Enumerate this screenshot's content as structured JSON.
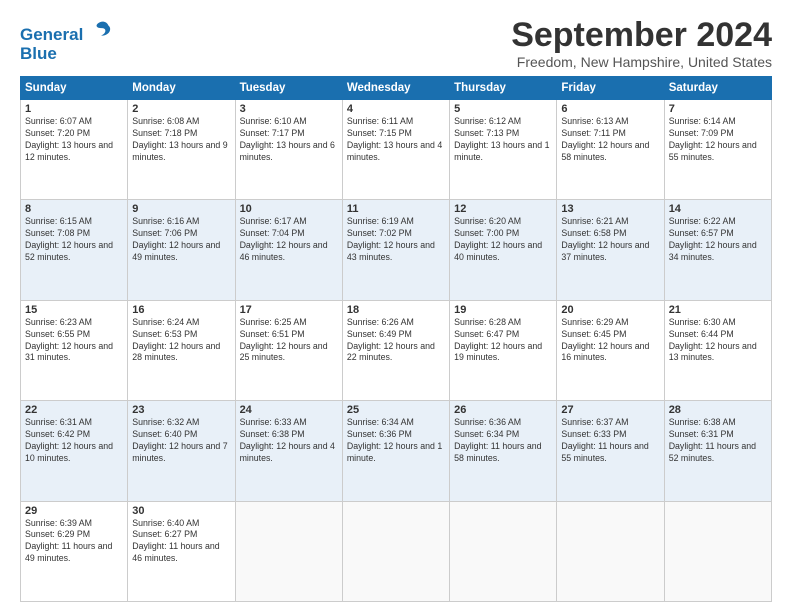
{
  "header": {
    "logo_line1": "General",
    "logo_line2": "Blue",
    "title": "September 2024",
    "location": "Freedom, New Hampshire, United States"
  },
  "weekdays": [
    "Sunday",
    "Monday",
    "Tuesday",
    "Wednesday",
    "Thursday",
    "Friday",
    "Saturday"
  ],
  "weeks": [
    [
      {
        "day": "1",
        "sunrise": "Sunrise: 6:07 AM",
        "sunset": "Sunset: 7:20 PM",
        "daylight": "Daylight: 13 hours and 12 minutes."
      },
      {
        "day": "2",
        "sunrise": "Sunrise: 6:08 AM",
        "sunset": "Sunset: 7:18 PM",
        "daylight": "Daylight: 13 hours and 9 minutes."
      },
      {
        "day": "3",
        "sunrise": "Sunrise: 6:10 AM",
        "sunset": "Sunset: 7:17 PM",
        "daylight": "Daylight: 13 hours and 6 minutes."
      },
      {
        "day": "4",
        "sunrise": "Sunrise: 6:11 AM",
        "sunset": "Sunset: 7:15 PM",
        "daylight": "Daylight: 13 hours and 4 minutes."
      },
      {
        "day": "5",
        "sunrise": "Sunrise: 6:12 AM",
        "sunset": "Sunset: 7:13 PM",
        "daylight": "Daylight: 13 hours and 1 minute."
      },
      {
        "day": "6",
        "sunrise": "Sunrise: 6:13 AM",
        "sunset": "Sunset: 7:11 PM",
        "daylight": "Daylight: 12 hours and 58 minutes."
      },
      {
        "day": "7",
        "sunrise": "Sunrise: 6:14 AM",
        "sunset": "Sunset: 7:09 PM",
        "daylight": "Daylight: 12 hours and 55 minutes."
      }
    ],
    [
      {
        "day": "8",
        "sunrise": "Sunrise: 6:15 AM",
        "sunset": "Sunset: 7:08 PM",
        "daylight": "Daylight: 12 hours and 52 minutes."
      },
      {
        "day": "9",
        "sunrise": "Sunrise: 6:16 AM",
        "sunset": "Sunset: 7:06 PM",
        "daylight": "Daylight: 12 hours and 49 minutes."
      },
      {
        "day": "10",
        "sunrise": "Sunrise: 6:17 AM",
        "sunset": "Sunset: 7:04 PM",
        "daylight": "Daylight: 12 hours and 46 minutes."
      },
      {
        "day": "11",
        "sunrise": "Sunrise: 6:19 AM",
        "sunset": "Sunset: 7:02 PM",
        "daylight": "Daylight: 12 hours and 43 minutes."
      },
      {
        "day": "12",
        "sunrise": "Sunrise: 6:20 AM",
        "sunset": "Sunset: 7:00 PM",
        "daylight": "Daylight: 12 hours and 40 minutes."
      },
      {
        "day": "13",
        "sunrise": "Sunrise: 6:21 AM",
        "sunset": "Sunset: 6:58 PM",
        "daylight": "Daylight: 12 hours and 37 minutes."
      },
      {
        "day": "14",
        "sunrise": "Sunrise: 6:22 AM",
        "sunset": "Sunset: 6:57 PM",
        "daylight": "Daylight: 12 hours and 34 minutes."
      }
    ],
    [
      {
        "day": "15",
        "sunrise": "Sunrise: 6:23 AM",
        "sunset": "Sunset: 6:55 PM",
        "daylight": "Daylight: 12 hours and 31 minutes."
      },
      {
        "day": "16",
        "sunrise": "Sunrise: 6:24 AM",
        "sunset": "Sunset: 6:53 PM",
        "daylight": "Daylight: 12 hours and 28 minutes."
      },
      {
        "day": "17",
        "sunrise": "Sunrise: 6:25 AM",
        "sunset": "Sunset: 6:51 PM",
        "daylight": "Daylight: 12 hours and 25 minutes."
      },
      {
        "day": "18",
        "sunrise": "Sunrise: 6:26 AM",
        "sunset": "Sunset: 6:49 PM",
        "daylight": "Daylight: 12 hours and 22 minutes."
      },
      {
        "day": "19",
        "sunrise": "Sunrise: 6:28 AM",
        "sunset": "Sunset: 6:47 PM",
        "daylight": "Daylight: 12 hours and 19 minutes."
      },
      {
        "day": "20",
        "sunrise": "Sunrise: 6:29 AM",
        "sunset": "Sunset: 6:45 PM",
        "daylight": "Daylight: 12 hours and 16 minutes."
      },
      {
        "day": "21",
        "sunrise": "Sunrise: 6:30 AM",
        "sunset": "Sunset: 6:44 PM",
        "daylight": "Daylight: 12 hours and 13 minutes."
      }
    ],
    [
      {
        "day": "22",
        "sunrise": "Sunrise: 6:31 AM",
        "sunset": "Sunset: 6:42 PM",
        "daylight": "Daylight: 12 hours and 10 minutes."
      },
      {
        "day": "23",
        "sunrise": "Sunrise: 6:32 AM",
        "sunset": "Sunset: 6:40 PM",
        "daylight": "Daylight: 12 hours and 7 minutes."
      },
      {
        "day": "24",
        "sunrise": "Sunrise: 6:33 AM",
        "sunset": "Sunset: 6:38 PM",
        "daylight": "Daylight: 12 hours and 4 minutes."
      },
      {
        "day": "25",
        "sunrise": "Sunrise: 6:34 AM",
        "sunset": "Sunset: 6:36 PM",
        "daylight": "Daylight: 12 hours and 1 minute."
      },
      {
        "day": "26",
        "sunrise": "Sunrise: 6:36 AM",
        "sunset": "Sunset: 6:34 PM",
        "daylight": "Daylight: 11 hours and 58 minutes."
      },
      {
        "day": "27",
        "sunrise": "Sunrise: 6:37 AM",
        "sunset": "Sunset: 6:33 PM",
        "daylight": "Daylight: 11 hours and 55 minutes."
      },
      {
        "day": "28",
        "sunrise": "Sunrise: 6:38 AM",
        "sunset": "Sunset: 6:31 PM",
        "daylight": "Daylight: 11 hours and 52 minutes."
      }
    ],
    [
      {
        "day": "29",
        "sunrise": "Sunrise: 6:39 AM",
        "sunset": "Sunset: 6:29 PM",
        "daylight": "Daylight: 11 hours and 49 minutes."
      },
      {
        "day": "30",
        "sunrise": "Sunrise: 6:40 AM",
        "sunset": "Sunset: 6:27 PM",
        "daylight": "Daylight: 11 hours and 46 minutes."
      },
      null,
      null,
      null,
      null,
      null
    ]
  ]
}
